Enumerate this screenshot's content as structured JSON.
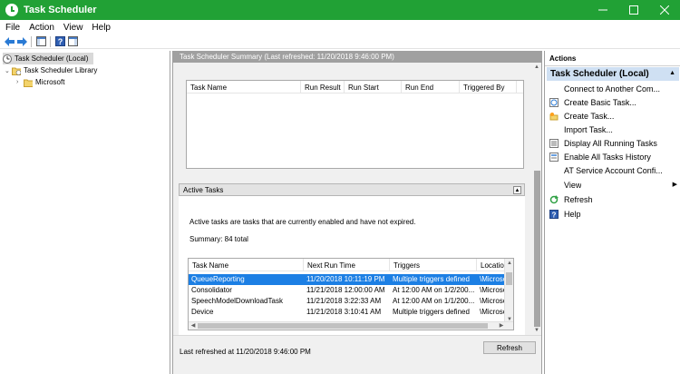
{
  "window": {
    "title": "Task Scheduler"
  },
  "menu": [
    "File",
    "Action",
    "View",
    "Help"
  ],
  "tree": {
    "root": "Task Scheduler (Local)",
    "library": "Task Scheduler Library",
    "child": "Microsoft"
  },
  "center": {
    "header": "Task Scheduler Summary (Last refreshed: 11/20/2018 9:46:00 PM)",
    "summary_table": {
      "columns": [
        "Task Name",
        "Run Result",
        "Run Start",
        "Run End",
        "Triggered By"
      ]
    },
    "active_tasks": {
      "title": "Active Tasks",
      "description": "Active tasks are tasks that are currently enabled and have not expired.",
      "summary": "Summary: 84 total",
      "columns": [
        "Task Name",
        "Next Run Time",
        "Triggers",
        "Location"
      ],
      "rows": [
        [
          "QueueReporting",
          "11/20/2018 10:11:19 PM",
          "Multiple triggers defined",
          "\\Microsoft"
        ],
        [
          "Consolidator",
          "11/21/2018 12:00:00 AM",
          "At 12:00 AM on 1/2/200...",
          "\\Microsoft"
        ],
        [
          "SpeechModelDownloadTask",
          "11/21/2018 3:22:33 AM",
          "At 12:00 AM on 1/1/200...",
          "\\Microsoft"
        ],
        [
          "Device",
          "11/21/2018 3:10:41 AM",
          "Multiple triggers defined",
          "\\Microsoft"
        ]
      ]
    },
    "footer": {
      "last_refreshed": "Last refreshed at 11/20/2018 9:46:00 PM",
      "refresh_button": "Refresh"
    }
  },
  "actions": {
    "title": "Actions",
    "section": "Task Scheduler (Local)",
    "items": [
      {
        "label": "Connect to Another Com...",
        "icon": "none"
      },
      {
        "label": "Create Basic Task...",
        "icon": "create-basic-task-icon"
      },
      {
        "label": "Create Task...",
        "icon": "create-task-icon"
      },
      {
        "label": "Import Task...",
        "icon": "none"
      },
      {
        "label": "Display All Running Tasks",
        "icon": "running-tasks-icon"
      },
      {
        "label": "Enable All Tasks History",
        "icon": "history-icon"
      },
      {
        "label": "AT Service Account Confi...",
        "icon": "none"
      },
      {
        "label": "View",
        "icon": "none"
      },
      {
        "label": "Refresh",
        "icon": "refresh-icon"
      },
      {
        "label": "Help",
        "icon": "help-icon"
      }
    ]
  },
  "colors": {
    "titlebar": "#21a135",
    "selection": "#1c7fe4",
    "actions_header": "#cfe0f3"
  }
}
